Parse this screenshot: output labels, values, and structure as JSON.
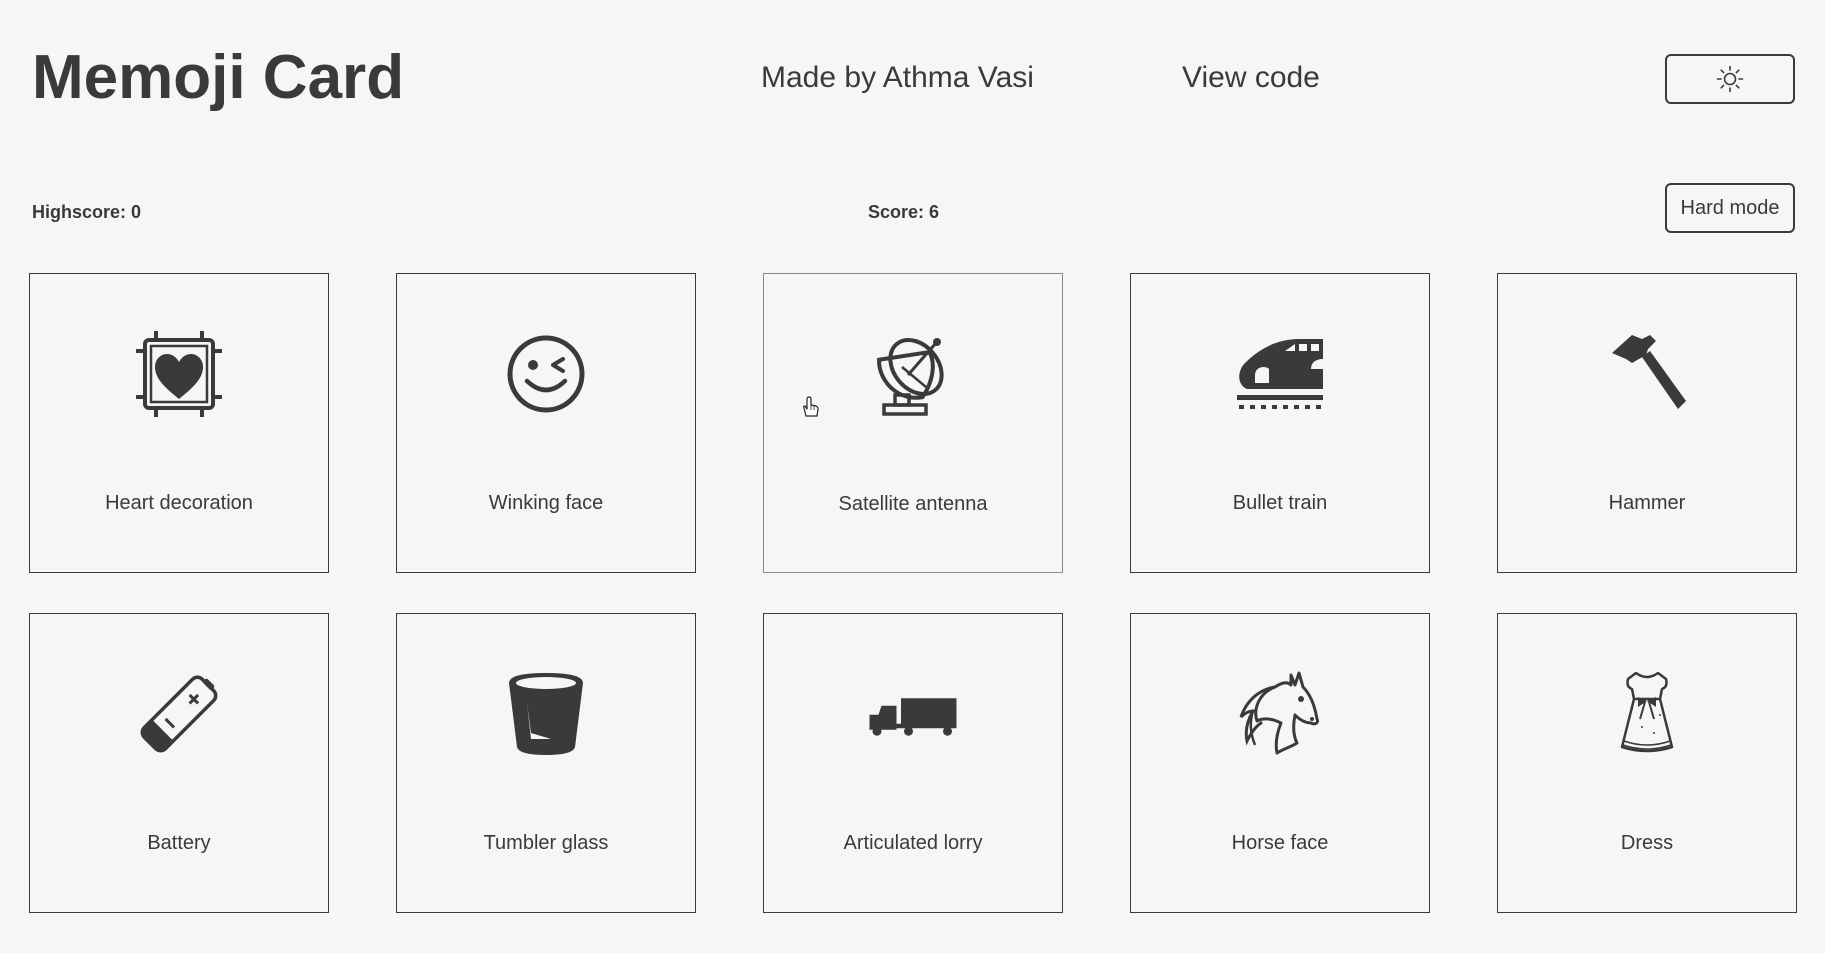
{
  "header": {
    "title": "Memoji Card",
    "made_by": "Made by Athma Vasi",
    "view_code": "View code",
    "theme_icon": "sun-icon"
  },
  "scores": {
    "highscore": "Highscore: 0",
    "score": "Score: 6",
    "hard_mode": "Hard mode"
  },
  "cards": [
    {
      "label": "Heart decoration",
      "icon": "heart-decoration-icon"
    },
    {
      "label": "Winking face",
      "icon": "winking-face-icon"
    },
    {
      "label": "Satellite antenna",
      "icon": "satellite-antenna-icon"
    },
    {
      "label": "Bullet train",
      "icon": "bullet-train-icon"
    },
    {
      "label": "Hammer",
      "icon": "hammer-icon"
    },
    {
      "label": "Battery",
      "icon": "battery-icon"
    },
    {
      "label": "Tumbler glass",
      "icon": "tumbler-glass-icon"
    },
    {
      "label": "Articulated lorry",
      "icon": "articulated-lorry-icon"
    },
    {
      "label": "Horse face",
      "icon": "horse-face-icon"
    },
    {
      "label": "Dress",
      "icon": "dress-icon"
    }
  ],
  "colors": {
    "background": "#f6f6f6",
    "foreground": "#3a3a3a"
  }
}
